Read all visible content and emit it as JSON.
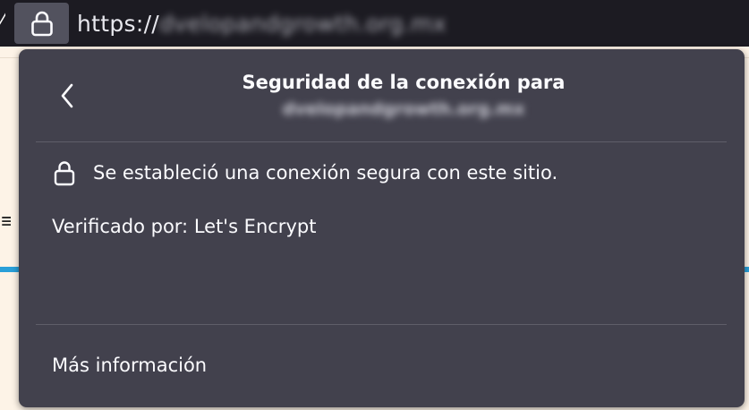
{
  "urlbar": {
    "scheme": "https://",
    "host": "dvelopandgrowth.org.mx",
    "lock_icon": "lock-icon"
  },
  "panel": {
    "title": "Seguridad de la conexión para",
    "host": "dvelopandgrowth.org.mx",
    "back_icon": "chevron-left-icon",
    "secure_message": "Se estableció una conexión segura con este sitio.",
    "verified_by": "Verificado por: Let's Encrypt",
    "more_info": "Más información"
  },
  "colors": {
    "urlbar_bg": "#1c1b22",
    "lock_button_bg": "#52525e",
    "panel_bg": "#42414d",
    "panel_text": "#fbfbfe",
    "page_bg": "#fdf3e7",
    "page_accent": "#2a9fd8"
  }
}
